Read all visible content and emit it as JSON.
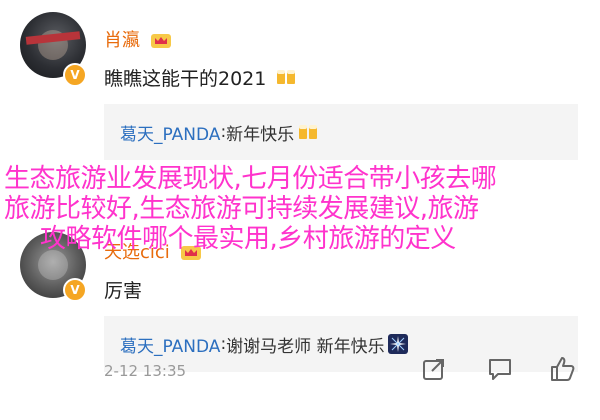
{
  "comments": [
    {
      "username": "肖瀛",
      "text": "瞧瞧这能干的2021",
      "reply": {
        "user": "葛天_PANDA",
        "separator": ": ",
        "text": "新年快乐"
      }
    },
    {
      "username": "天选cici",
      "text": "厉害",
      "reply": {
        "user": "葛天_PANDA",
        "separator": ": ",
        "text": "谢谢马老师 新年快乐"
      }
    }
  ],
  "footer": {
    "timestamp": "2-12 13:35"
  },
  "overlay": {
    "line1": "生态旅游业发展现状,七月份适合带小孩去哪",
    "line2": "旅游比较好,生态旅游可持续发展建议,旅游",
    "line3": "攻略软件哪个最实用,乡村旅游的定义"
  },
  "icons": {
    "verified": "verified-badge-icon",
    "crown": "crown-icon",
    "beer": "beer-cheers-icon",
    "sparkle": "sparkle-icon",
    "share": "share-icon",
    "comment": "comment-icon",
    "like": "like-icon"
  },
  "colors": {
    "username": "#e86b0c",
    "reply_user": "#2c6fbf",
    "overlay": "#ff33cc",
    "verified": "#f5a623"
  }
}
